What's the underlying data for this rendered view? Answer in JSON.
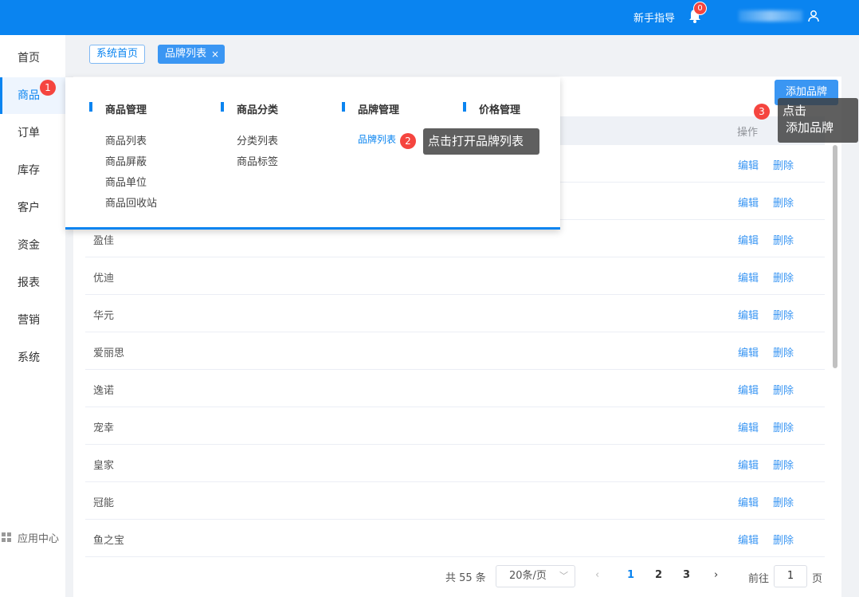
{
  "header": {
    "guide_label": "新手指导",
    "notification_count": "0"
  },
  "sidebar": {
    "items": [
      "首页",
      "商品",
      "订单",
      "库存",
      "客户",
      "资金",
      "报表",
      "营销",
      "系统"
    ],
    "active_index": 1,
    "app_center": "应用中心"
  },
  "tags": {
    "home": "系统首页",
    "current": "品牌列表",
    "close": "×"
  },
  "toolbar": {
    "add_label": "添加品牌"
  },
  "table": {
    "op_header": "操作",
    "edit_label": "编辑",
    "delete_label": "删除",
    "rows": [
      "",
      "",
      "盈佳",
      "优迪",
      "华元",
      "爱丽思",
      "逸诺",
      "宠幸",
      "皇家",
      "冠能",
      "鱼之宝"
    ]
  },
  "pagination": {
    "total": "共 55 条",
    "page_size": "20条/页",
    "pages": [
      "1",
      "2",
      "3"
    ],
    "current_page": "1",
    "goto_label": "前往",
    "goto_value": "1",
    "goto_unit": "页",
    "prev_icon": "‹",
    "next_icon": "›"
  },
  "dropdown": {
    "columns": [
      {
        "title": "商品管理",
        "links": [
          "商品列表",
          "商品屏蔽",
          "商品单位",
          "商品回收站"
        ]
      },
      {
        "title": "商品分类",
        "links": [
          "分类列表",
          "商品标签"
        ]
      },
      {
        "title": "品牌管理",
        "links": [
          "品牌列表"
        ]
      },
      {
        "title": "价格管理",
        "links": []
      }
    ]
  },
  "guides": {
    "step1": "1",
    "step2": "2",
    "step3": "3",
    "tip2": "点击打开品牌列表",
    "tip3_line1": "点击",
    "tip3_line2": "添加品牌"
  },
  "colors": {
    "primary": "#0a84f0",
    "badge": "#f5453f"
  }
}
